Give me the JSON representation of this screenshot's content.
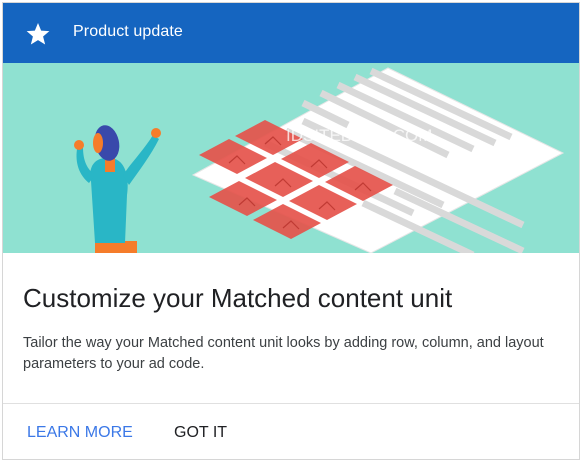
{
  "header": {
    "title": "Product update",
    "icon": "star-icon",
    "background": "#1565c0"
  },
  "banner": {
    "watermark": "IDSITEBLOG.COM",
    "background": "#8fe1d1"
  },
  "main": {
    "title": "Customize your Matched content unit",
    "description": "Tailor the way your Matched content unit looks by adding row, column, and layout parameters to your ad code."
  },
  "actions": {
    "learn_more": "LEARN MORE",
    "got_it": "GOT IT",
    "accent": "#3b78e7"
  }
}
